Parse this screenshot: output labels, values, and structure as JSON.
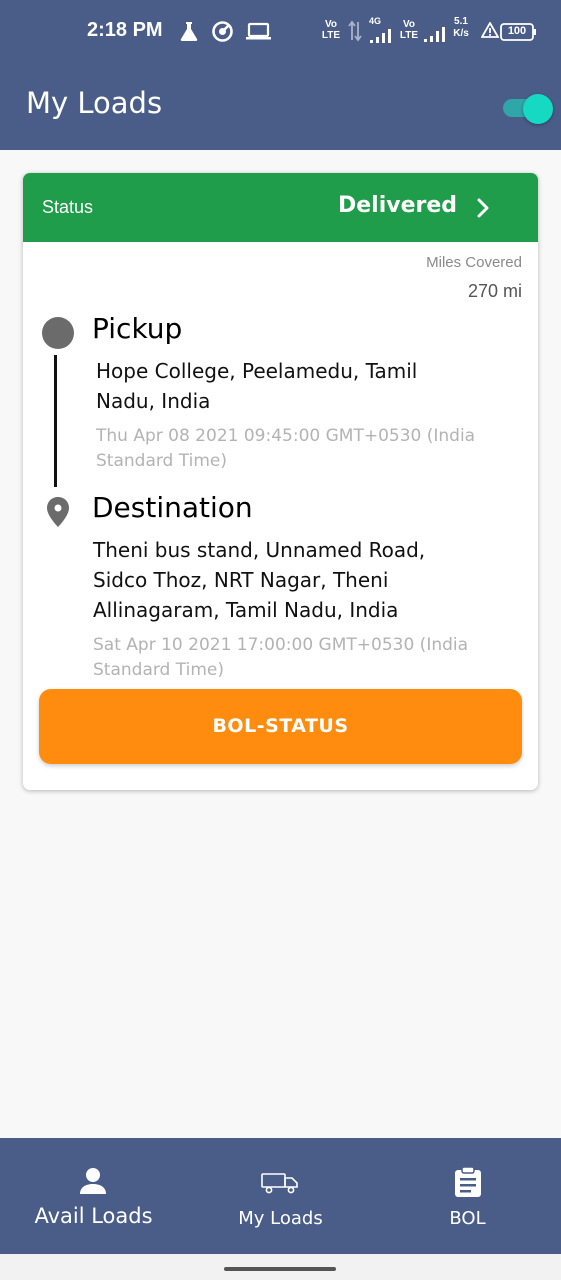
{
  "status_bar": {
    "time": "2:18 PM",
    "sim1": {
      "top": "Vo",
      "bottom": "LTE"
    },
    "network_4g": "4G",
    "sim2": {
      "top": "Vo",
      "bottom": "LTE"
    },
    "speed": {
      "value": "5.1",
      "unit": "K/s"
    },
    "battery": "100",
    "icons": [
      "flask-icon",
      "vpn-icon",
      "laptop-icon",
      "data-transfer-icon",
      "signal-icon",
      "alert-icon",
      "battery-icon"
    ]
  },
  "app_bar": {
    "title": "My Loads",
    "toggle_on": true,
    "colors": {
      "background": "#4a5d88",
      "toggle": "#16d9c4"
    }
  },
  "load_card": {
    "status_label": "Status",
    "status_value": "Delivered",
    "status_color": "#1f9d4a",
    "miles_label": "Miles Covered",
    "miles_value": "270 mi",
    "pickup": {
      "title": "Pickup",
      "address_lines": [
        "Hope College, Peelamedu, Tamil",
        "Nadu, India"
      ],
      "datetime_lines": [
        "Thu Apr 08 2021 09:45:00 GMT+0530 (India",
        "Standard Time)"
      ]
    },
    "destination": {
      "title": "Destination",
      "address_lines": [
        "Theni bus stand, Unnamed Road,",
        "Sidco Thoz, NRT Nagar, Theni",
        "Allinagaram, Tamil Nadu, India"
      ],
      "datetime_lines": [
        "Sat Apr 10 2021 17:00:00 GMT+0530 (India",
        "Standard Time)"
      ]
    },
    "bol_button": "BOL-STATUS",
    "bol_color": "#ff8c0f"
  },
  "bottom_nav": {
    "items": [
      {
        "label": "Avail Loads",
        "icon": "person-icon"
      },
      {
        "label": "My Loads",
        "icon": "truck-icon"
      },
      {
        "label": "BOL",
        "icon": "clipboard-icon"
      }
    ]
  }
}
